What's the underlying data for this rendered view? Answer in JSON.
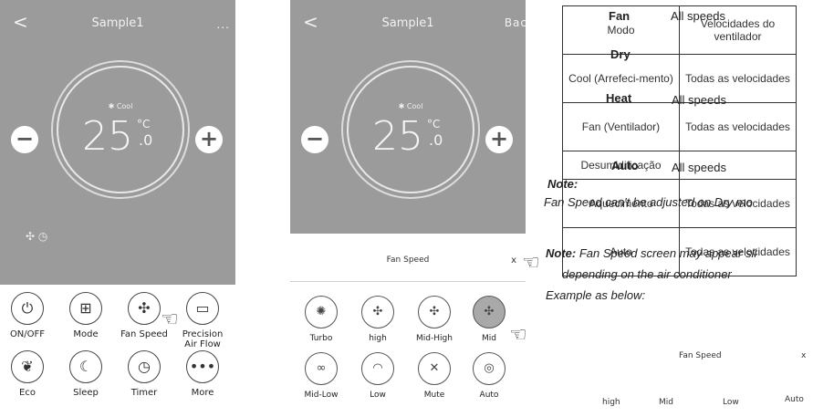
{
  "phone1": {
    "title": "Sample1",
    "back": "<",
    "more": "...",
    "mode": "Cool",
    "temp": "25",
    "unit": "°C",
    "decimal": ".0",
    "minus": "−",
    "plus": "+",
    "buttons": [
      {
        "label": "ON/OFF",
        "icon": "⏻"
      },
      {
        "label": "Mode",
        "icon": "⊞"
      },
      {
        "label": "Fan Speed",
        "icon": "✣"
      },
      {
        "label": "Precision\nAir Flow",
        "icon": "▭"
      },
      {
        "label": "Eco",
        "icon": "❦"
      },
      {
        "label": "Sleep",
        "icon": "☾"
      },
      {
        "label": "Timer",
        "icon": "◷"
      },
      {
        "label": "More",
        "icon": "•••"
      }
    ]
  },
  "phone2": {
    "title": "Sample1",
    "back": "<",
    "right_text": "Bac",
    "mode": "Cool",
    "temp": "25",
    "unit": "°C",
    "decimal": ".0",
    "minus": "−",
    "plus": "+",
    "sheet_title": "Fan Speed",
    "close": "x",
    "options": [
      {
        "label": "Turbo",
        "icon": "✺",
        "selected": false
      },
      {
        "label": "high",
        "icon": "✣",
        "selected": false
      },
      {
        "label": "Mid-High",
        "icon": "✣",
        "selected": false
      },
      {
        "label": "Mid",
        "icon": "✣",
        "selected": true
      },
      {
        "label": "Mid-Low",
        "icon": "∞",
        "selected": false
      },
      {
        "label": "Low",
        "icon": "◠",
        "selected": false
      },
      {
        "label": "Mute",
        "icon": "✕",
        "selected": false
      },
      {
        "label": "Auto",
        "icon": "◎",
        "selected": false
      }
    ]
  },
  "table": {
    "rows": [
      [
        "Modo",
        "Velocidades do ventilador"
      ],
      [
        "Cool (Arrefeci-mento)",
        "Todas as velocidades"
      ],
      [
        "Fan (Ventilador)",
        "Todas as velocidades"
      ],
      [
        "Desumidificação",
        ""
      ],
      [
        "Aquecimento",
        "Todas as velocidades"
      ],
      [
        "Auto",
        "Todas as velocidades"
      ]
    ]
  },
  "overlay": {
    "fan": "Fan",
    "all1": "All speeds",
    "dry": "Dry",
    "heat": "Heat",
    "all2": "All speeds",
    "auto": "Auto",
    "all3": "All speeds",
    "note1_label": "Note:",
    "note1_text": "Fan Speed can't be adjusted on Dry mo",
    "note2_label": "Note:",
    "note2_text": " Fan Speed screen may appear sli",
    "note2_line2": "depending on the air conditioner",
    "note2_line3": "Example as below:"
  },
  "mini_sheet": {
    "title": "Fan Speed",
    "close": "x",
    "options": [
      "high",
      "Mid",
      "Low",
      "Auto"
    ]
  }
}
